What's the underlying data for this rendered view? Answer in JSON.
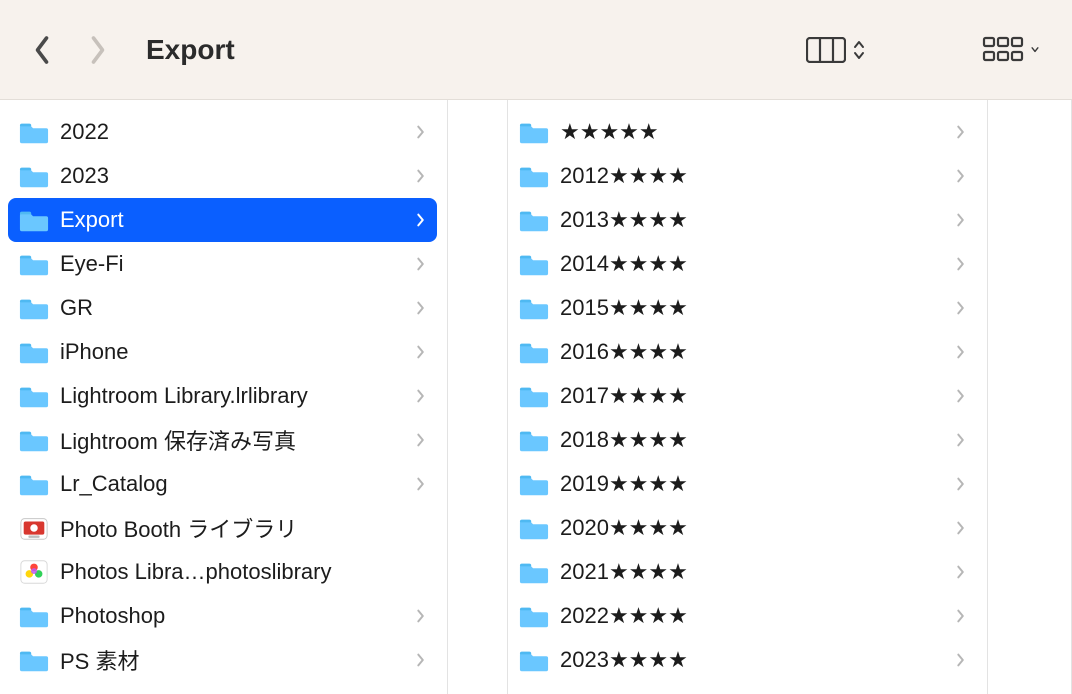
{
  "toolbar": {
    "title": "Export"
  },
  "columns": {
    "left": [
      {
        "name": "2022",
        "icon": "folder",
        "selected": false,
        "hasChildren": true
      },
      {
        "name": "2023",
        "icon": "folder",
        "selected": false,
        "hasChildren": true
      },
      {
        "name": "Export",
        "icon": "folder",
        "selected": true,
        "hasChildren": true
      },
      {
        "name": "Eye-Fi",
        "icon": "folder",
        "selected": false,
        "hasChildren": true
      },
      {
        "name": "GR",
        "icon": "folder",
        "selected": false,
        "hasChildren": true
      },
      {
        "name": "iPhone",
        "icon": "folder",
        "selected": false,
        "hasChildren": true
      },
      {
        "name": "Lightroom Library.lrlibrary",
        "icon": "folder",
        "selected": false,
        "hasChildren": true
      },
      {
        "name": "Lightroom 保存済み写真",
        "icon": "folder",
        "selected": false,
        "hasChildren": true
      },
      {
        "name": "Lr_Catalog",
        "icon": "folder",
        "selected": false,
        "hasChildren": true
      },
      {
        "name": "Photo Booth ライブラリ",
        "icon": "photobooth",
        "selected": false,
        "hasChildren": false
      },
      {
        "name": "Photos Libra…photoslibrary",
        "icon": "photos",
        "selected": false,
        "hasChildren": false
      },
      {
        "name": "Photoshop",
        "icon": "folder",
        "selected": false,
        "hasChildren": true
      },
      {
        "name": "PS 素材",
        "icon": "folder",
        "selected": false,
        "hasChildren": true
      }
    ],
    "right": [
      {
        "name": "★★★★★",
        "icon": "folder",
        "hasChildren": true
      },
      {
        "name": "2012★★★★",
        "icon": "folder",
        "hasChildren": true
      },
      {
        "name": "2013★★★★",
        "icon": "folder",
        "hasChildren": true
      },
      {
        "name": "2014★★★★",
        "icon": "folder",
        "hasChildren": true
      },
      {
        "name": "2015★★★★",
        "icon": "folder",
        "hasChildren": true
      },
      {
        "name": "2016★★★★",
        "icon": "folder",
        "hasChildren": true
      },
      {
        "name": "2017★★★★",
        "icon": "folder",
        "hasChildren": true
      },
      {
        "name": "2018★★★★",
        "icon": "folder",
        "hasChildren": true
      },
      {
        "name": "2019★★★★",
        "icon": "folder",
        "hasChildren": true
      },
      {
        "name": "2020★★★★",
        "icon": "folder",
        "hasChildren": true
      },
      {
        "name": "2021★★★★",
        "icon": "folder",
        "hasChildren": true
      },
      {
        "name": "2022★★★★",
        "icon": "folder",
        "hasChildren": true
      },
      {
        "name": "2023★★★★",
        "icon": "folder",
        "hasChildren": true
      }
    ]
  }
}
